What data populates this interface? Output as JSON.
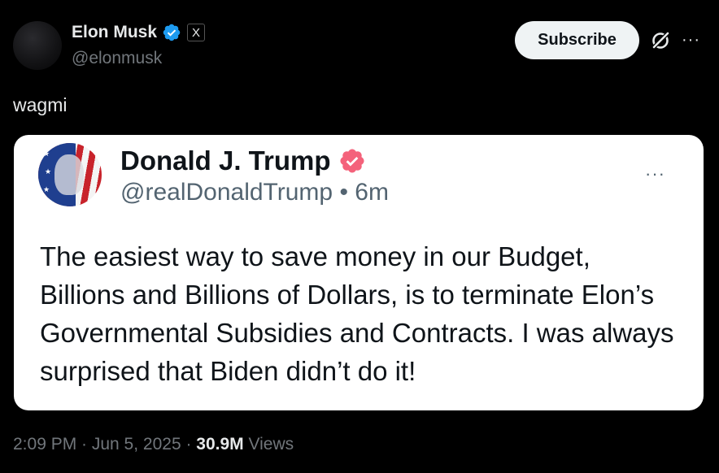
{
  "author": {
    "display_name": "Elon Musk",
    "handle": "@elonmusk",
    "affiliate_label": "X"
  },
  "actions": {
    "subscribe_label": "Subscribe",
    "more_label": "···"
  },
  "post": {
    "text": "wagmi"
  },
  "quoted_post": {
    "display_name": "Donald J. Trump",
    "meta": "@realDonaldTrump • 6m",
    "more_label": "···",
    "body": "The easiest way to save money in our Budget, Billions and Billions of Dollars, is to terminate Elon’s Governmental Subsidies and Contracts. I was always surprised that Biden didn’t do it!"
  },
  "footer": {
    "timestamp": "2:09 PM · Jun 5, 2025 · ",
    "views_count": "30.9M",
    "views_label": " Views"
  },
  "colors": {
    "background": "#000000",
    "verified_blue": "#1d9bf0",
    "verified_pink": "#f4627b",
    "card_bg": "#ffffff"
  }
}
